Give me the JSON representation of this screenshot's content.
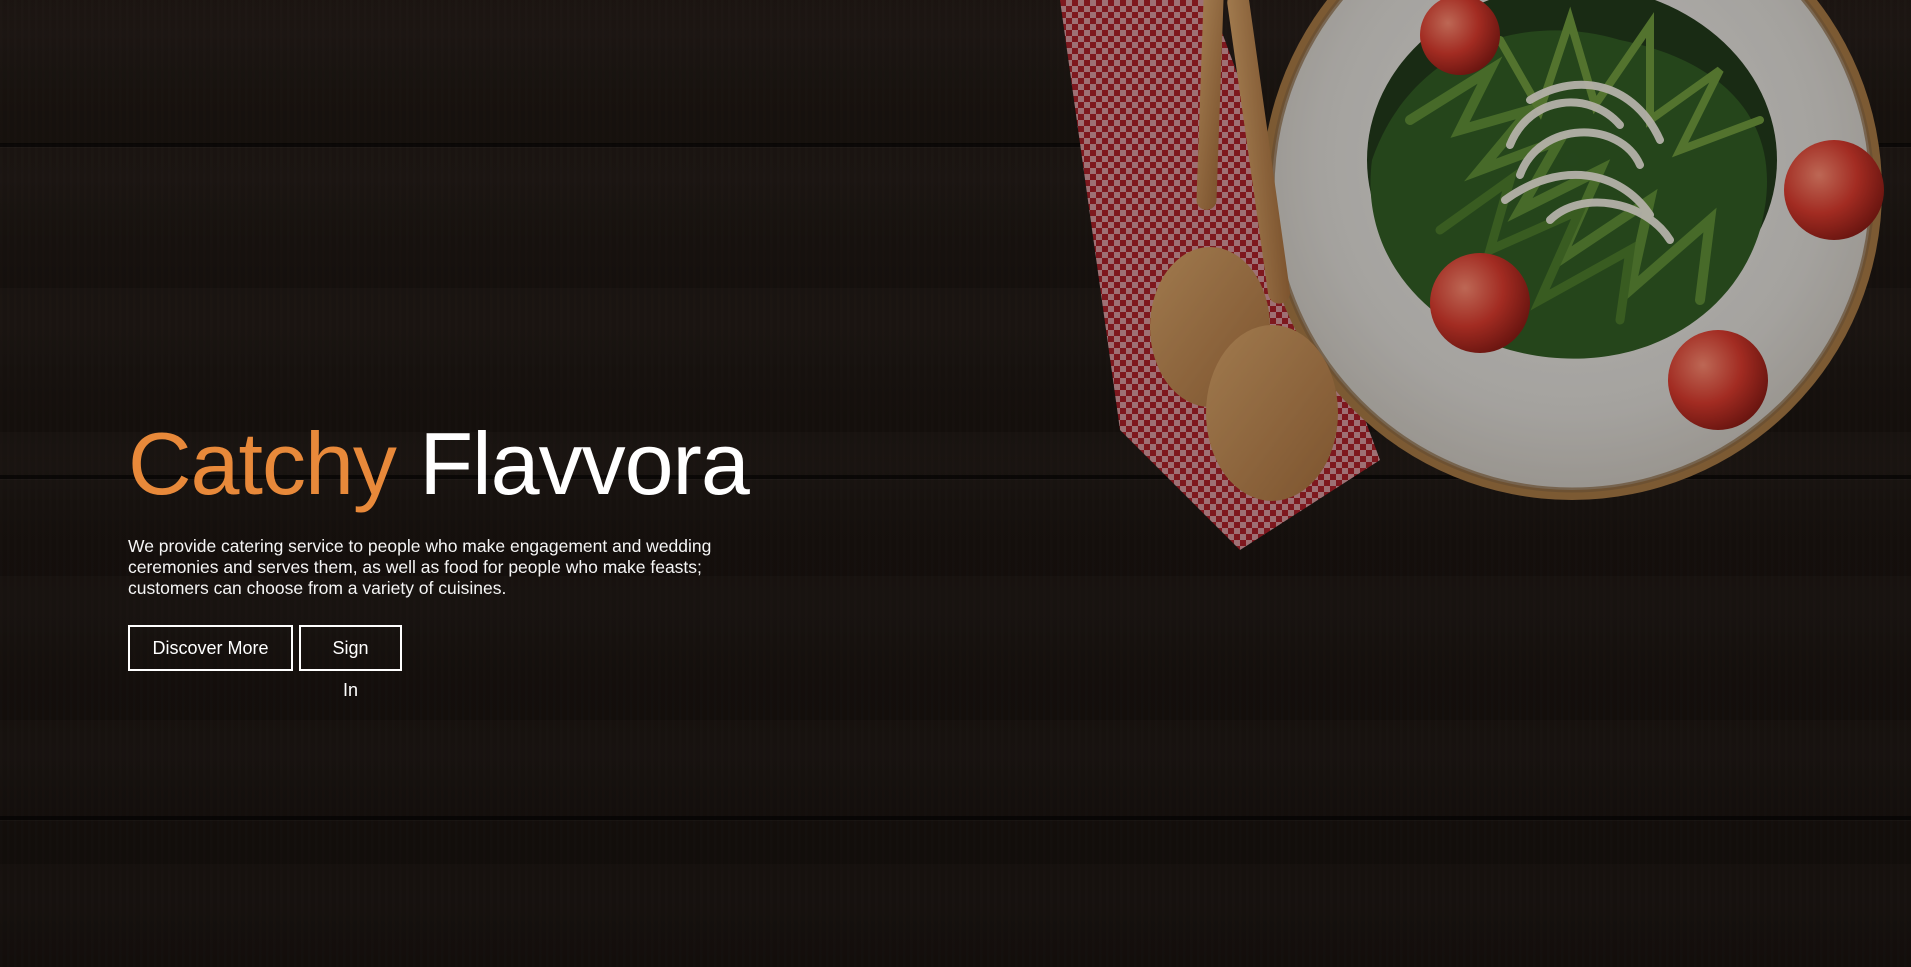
{
  "hero": {
    "title_accent": "Catchy",
    "title_main": "Flavvora",
    "description": "We provide catering service to people who make engagement and wedding ceremonies and serves them, as well as food for people who make feasts; customers can choose from a variety of cuisines.",
    "buttons": [
      {
        "label": "Discover More"
      },
      {
        "label": "Sign In"
      }
    ]
  },
  "colors": {
    "accent": "#e8893a",
    "text": "#ffffff",
    "background": "#221a15"
  },
  "icons": {
    "food_image": "salad-plate-with-wooden-spoons"
  }
}
